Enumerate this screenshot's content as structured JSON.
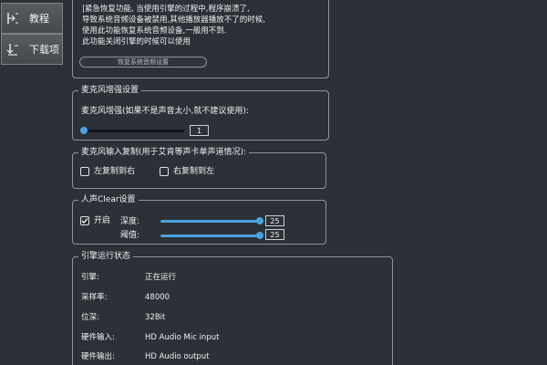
{
  "sidebar": {
    "items": [
      {
        "label": "教程",
        "icon": "tutorial-icon"
      },
      {
        "label": "下载项",
        "icon": "download-icon"
      }
    ]
  },
  "emergency": {
    "lines": [
      "|紧急恢复功能, 当使用引擎的过程中,程序崩溃了,",
      "导致系统音频设备被禁用,其他播放器播放不了的时候,",
      "使用此功能恢复系统音频设备,一般用不到.",
      "此功能关闭引擎的时候可以使用"
    ],
    "button_label": "恢复系统音频设置"
  },
  "mic_boost": {
    "title": "麦克风增强设置",
    "label": "麦克风增强(如果不是声音太小,就不建议使用):",
    "value": "1",
    "level": 0
  },
  "mic_copy": {
    "title": "麦克风输入复制(用于艾肯等声卡单声道情况):",
    "options": [
      {
        "label": "左复制到右",
        "checked": false
      },
      {
        "label": "右复制到左",
        "checked": false
      }
    ]
  },
  "voice_clear": {
    "title": "人声Clear设置",
    "enable_label": "开启",
    "enabled": true,
    "depth_label": "深度:",
    "depth_value": "25",
    "depth_level": 1.0,
    "threshold_label": "阈值:",
    "threshold_value": "25",
    "threshold_level": 1.0
  },
  "engine_status": {
    "title": "引擎运行状态",
    "rows": [
      {
        "label": "引擎:",
        "value": "正在运行"
      },
      {
        "label": "采样率:",
        "value": "48000"
      },
      {
        "label": "位深:",
        "value": "32Bit"
      },
      {
        "label": "硬件输入:",
        "value": "HD Audio Mic input"
      },
      {
        "label": "硬件输出:",
        "value": "HD Audio output"
      }
    ]
  },
  "colors": {
    "background": "#2b3137",
    "accent": "#4aa3df",
    "border": "#8c949b"
  }
}
